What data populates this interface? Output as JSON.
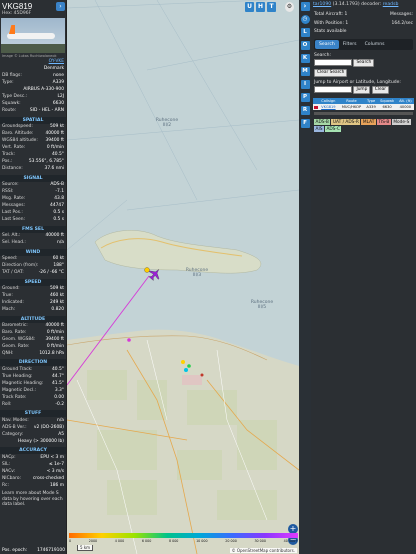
{
  "left": {
    "callsign": "VKG819",
    "hex_label": "Hex: 45D96F",
    "photo_credit": "Image © Lukas Ruchtwolaneok",
    "top_rows": [
      {
        "k": "",
        "v": "OY-VKE",
        "link": true
      },
      {
        "k": "",
        "v": "Denmark"
      },
      {
        "k": "DB flags:",
        "v": "none"
      },
      {
        "k": "Type:",
        "v": "A339"
      },
      {
        "k": "",
        "v": "AIRBUS A-330-900"
      },
      {
        "k": "Type Desc.:",
        "v": "L2J"
      },
      {
        "k": "Squawk:",
        "v": "6630"
      },
      {
        "k": "Route:",
        "v": "SID - HEL - ARN"
      }
    ],
    "sections": [
      {
        "title": "SPATIAL",
        "rows": [
          {
            "k": "Groundspeed:",
            "v": "509 kt"
          },
          {
            "k": "Baro. Altitude:",
            "v": "40000 ft"
          },
          {
            "k": "WGS84 altitude:",
            "v": "39400 ft"
          },
          {
            "k": "Vert. Rate:",
            "v": "0 ft/min"
          },
          {
            "k": "Track:",
            "v": "40.5°"
          },
          {
            "k": "Pos.:",
            "v": "53.556°, 6.785°"
          },
          {
            "k": "Distance:",
            "v": "37.6 nmi"
          }
        ]
      },
      {
        "title": "SIGNAL",
        "rows": [
          {
            "k": "Source:",
            "v": "ADS-B"
          },
          {
            "k": "RSSI:",
            "v": "-7.1"
          },
          {
            "k": "Msg. Rate:",
            "v": "43.8"
          },
          {
            "k": "Messages:",
            "v": "44747"
          },
          {
            "k": "Last Pos.:",
            "v": "0.5 s"
          },
          {
            "k": "Last Seen:",
            "v": "0.5 s"
          }
        ]
      },
      {
        "title": "FMS SEL",
        "rows": [
          {
            "k": "Sel. Alt.:",
            "v": "40000 ft"
          },
          {
            "k": "Sel. Head.:",
            "v": "n/a"
          }
        ]
      },
      {
        "title": "WIND",
        "rows": [
          {
            "k": "Speed:",
            "v": "60 kt"
          },
          {
            "k": "Direction (from):",
            "v": "188°"
          },
          {
            "k": "TAT / OAT:",
            "v": "-26 / -66 °C"
          }
        ]
      },
      {
        "title": "SPEED",
        "rows": [
          {
            "k": "Ground:",
            "v": "509 kt"
          },
          {
            "k": "True:",
            "v": "460 kt"
          },
          {
            "k": "Indicated:",
            "v": "249 kt"
          },
          {
            "k": "Mach:",
            "v": "0.820"
          }
        ]
      },
      {
        "title": "ALTITUDE",
        "rows": [
          {
            "k": "Barometric:",
            "v": "40000 ft"
          },
          {
            "k": "Baro. Rate:",
            "v": "0 ft/min"
          },
          {
            "k": "Geom. WGS84:",
            "v": "39400 ft"
          },
          {
            "k": "Geom. Rate:",
            "v": "0 ft/min"
          },
          {
            "k": "QNH:",
            "v": "1012.8 hPa"
          }
        ]
      },
      {
        "title": "DIRECTION",
        "rows": [
          {
            "k": "Ground Track:",
            "v": "40.5°"
          },
          {
            "k": "True Heading:",
            "v": "44.7°"
          },
          {
            "k": "Magnetic Heading:",
            "v": "41.5°"
          },
          {
            "k": "Magnetic Decl.:",
            "v": "3.3°"
          },
          {
            "k": "Track Rate:",
            "v": "0.00"
          },
          {
            "k": "Roll:",
            "v": "-0.2"
          }
        ]
      },
      {
        "title": "STUFF",
        "rows": [
          {
            "k": "Nav. Modes:",
            "v": "n/a"
          },
          {
            "k": "ADS-B Ver.:",
            "v": "v2 (DO-260B)"
          },
          {
            "k": "Category:",
            "v": "A5"
          },
          {
            "k": "",
            "v": "Heavy (> 300000 lb)"
          }
        ]
      },
      {
        "title": "ACCURACY",
        "rows": [
          {
            "k": "NACp:",
            "v": "EPU < 3 m"
          },
          {
            "k": "SIL:",
            "v": "≤ 1e-7"
          },
          {
            "k": "NACv:",
            "v": "< 3 m/s"
          },
          {
            "k": "NICbaro:",
            "v": "cross-checked"
          },
          {
            "k": "Rc:",
            "v": "186 m"
          }
        ]
      }
    ],
    "note": "Learn more about Mode S data by hovering over each data label.",
    "footer_key": "Pos. epoch:",
    "footer_val": "1746719100"
  },
  "map": {
    "buttons": [
      "U",
      "H",
      "T"
    ],
    "labels": [
      "Ruhecone III/2",
      "Ruhecone III/3",
      "Ruhecone III/5"
    ],
    "legend_ticks": [
      "0",
      "2000",
      "4 000",
      "6 000",
      "8 000",
      "10 000",
      "20 000",
      "30 000",
      "40 000+"
    ],
    "scale": "5 km",
    "attribution": "© OpenStreetMap contributors.",
    "zoom_in": "+",
    "zoom_out": "−"
  },
  "strip": {
    "buttons": [
      "L",
      "O",
      "K",
      "M",
      "I",
      "P",
      "R",
      "F"
    ]
  },
  "right": {
    "app_link": "tar1090",
    "version": "(3.14.1793) decoder:",
    "decoder_link": "readsb",
    "total_label": "Total Aircraft: 1",
    "messages_label": "Messages:",
    "messages_val": "164.2/sec",
    "withpos_label": "With Position: 1",
    "stats_label": "Stats available",
    "tabs": [
      "Search",
      "Filters",
      "Columns"
    ],
    "search_label": "Search:",
    "search_button": "Search",
    "clear_search": "Clear Search",
    "jump_label": "Jump to Airport or Latitude, Longitude:",
    "jump_button": "Jump",
    "clear_button": "Clear",
    "columns": [
      "Callsign",
      "Route",
      "Type",
      "Squawk",
      "Alt. (ft)"
    ],
    "rows": [
      {
        "callsign": "VKG819",
        "route": "MUC/HKOP",
        "type": "A339",
        "squawk": "6630",
        "alt": "40000"
      }
    ],
    "chips": [
      {
        "label": "ADS-B",
        "color": "#a7d8a7"
      },
      {
        "label": "UAT / ADS-R",
        "color": "#e0c585"
      },
      {
        "label": "MLAT",
        "color": "#e8a35a"
      },
      {
        "label": "TIS-B",
        "color": "#e58a8a"
      },
      {
        "label": "Mode-S",
        "color": "#d0d0d0"
      },
      {
        "label": "AIS",
        "color": "#9bb7e0"
      },
      {
        "label": "ADS-C",
        "color": "#a6e3b2"
      }
    ]
  }
}
